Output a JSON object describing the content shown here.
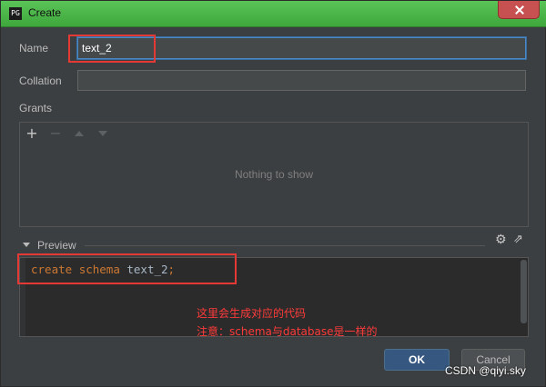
{
  "window": {
    "title": "Create",
    "app_icon": "PG"
  },
  "form": {
    "name_label": "Name",
    "name_value": "text_2",
    "collation_label": "Collation",
    "collation_value": "",
    "grants_label": "Grants",
    "grants_empty": "Nothing to show"
  },
  "grants_toolbar": {
    "add_icon": "plus-icon",
    "remove_icon": "minus-icon",
    "up_icon": "arrow-up-icon",
    "down_icon": "arrow-down-icon",
    "add_glyph": "+",
    "remove_glyph": "−"
  },
  "preview": {
    "label": "Preview",
    "settings_glyph": "⚙",
    "popout_glyph": "⇗",
    "code": {
      "kw1": "create",
      "kw2": "schema",
      "identifier": "text_2",
      "terminator": ";"
    }
  },
  "annotations": {
    "line1": "这里会生成对应的代码",
    "line2": "注意：schema与database是一样的"
  },
  "buttons": {
    "ok": "OK",
    "cancel": "Cancel"
  },
  "watermark": "CSDN @qiyi.sky",
  "colors": {
    "accent": "#4a88c7",
    "ok_button": "#365880",
    "annotation_red": "#e53935",
    "keyword": "#cc7832"
  }
}
